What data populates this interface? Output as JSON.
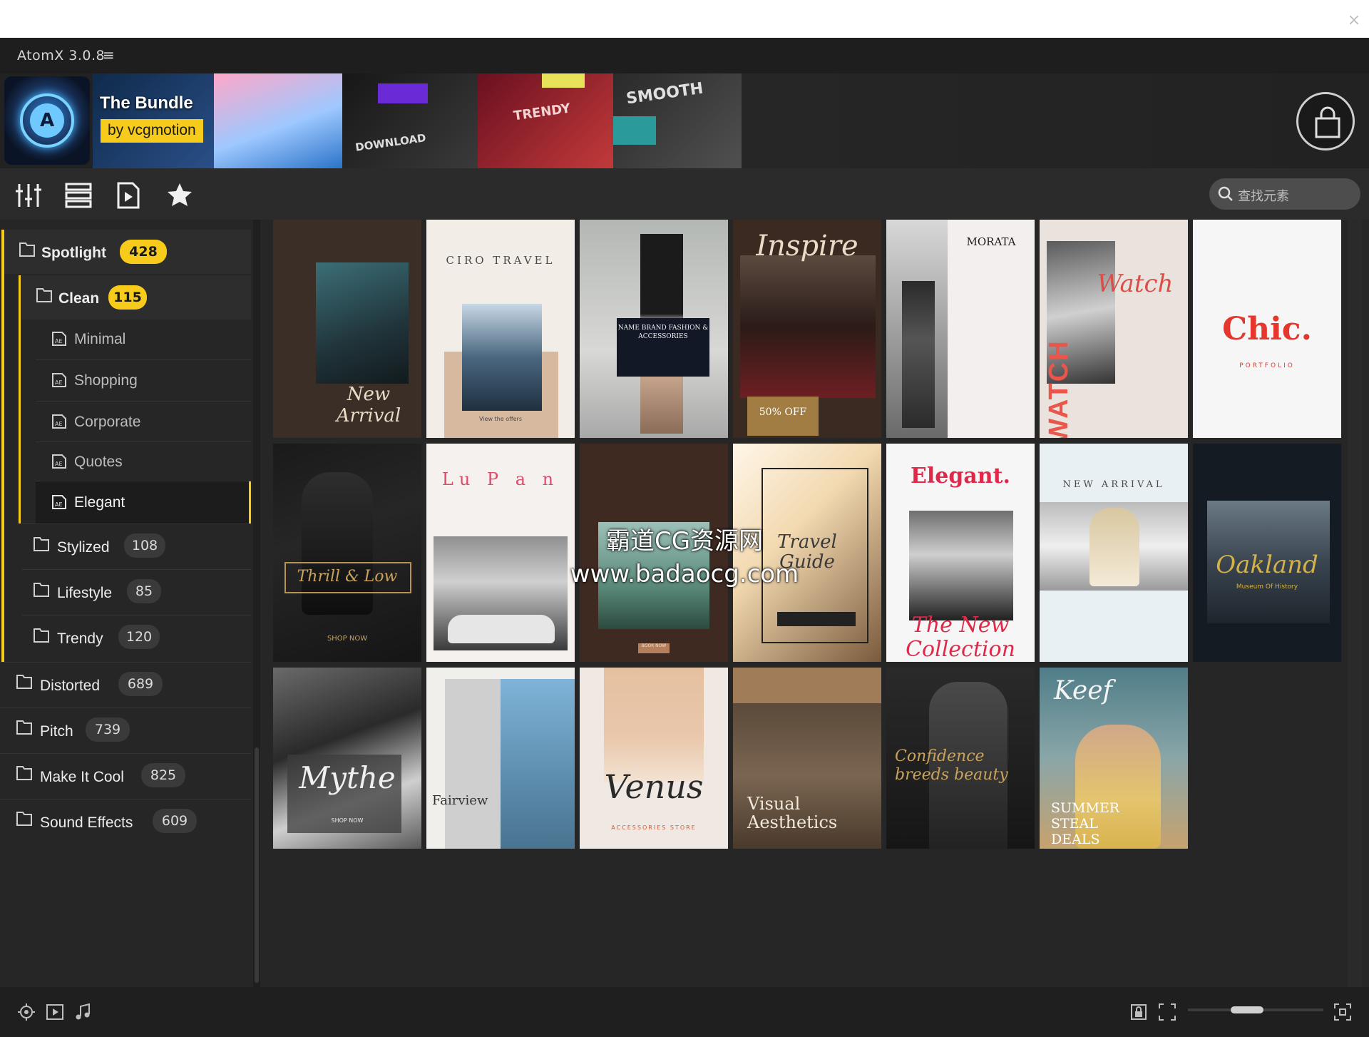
{
  "app": {
    "title": "AtomX 3.0.8",
    "menu_glyph": "≡",
    "close_glyph": "×"
  },
  "banner": {
    "title": "The Bundle",
    "byline": "by vcgmotion",
    "tile_texts": [
      "TRENDY",
      "DOWNLOAD",
      "SMOOTH",
      "TRENDY"
    ]
  },
  "toolbar": {
    "icons": [
      "sliders-icon",
      "list-icon",
      "video-file-icon",
      "star-icon"
    ],
    "search_placeholder": "查找元素"
  },
  "sidebar": {
    "categories": [
      {
        "label": "Spotlight",
        "count": "428"
      },
      {
        "label": "Clean",
        "count": "115"
      },
      {
        "label": "Minimal"
      },
      {
        "label": "Shopping"
      },
      {
        "label": "Corporate"
      },
      {
        "label": "Quotes"
      },
      {
        "label": "Elegant"
      },
      {
        "label": "Stylized",
        "count": "108"
      },
      {
        "label": "Lifestyle",
        "count": "85"
      },
      {
        "label": "Trendy",
        "count": "120"
      },
      {
        "label": "Distorted",
        "count": "689"
      },
      {
        "label": "Pitch",
        "count": "739"
      },
      {
        "label": "Make It Cool",
        "count": "825"
      },
      {
        "label": "Sound Effects",
        "count": "609"
      }
    ]
  },
  "grid": {
    "cards": [
      {
        "title": "New Arrival",
        "sub": ""
      },
      {
        "title": "CIRO TRAVEL",
        "sub": "View the offers"
      },
      {
        "title": "NAME BRAND FASHION & ACCESSORIES",
        "sub": ""
      },
      {
        "title": "Inspire",
        "sub": "50% OFF"
      },
      {
        "title": "MORATA",
        "sub": ""
      },
      {
        "title": "Watch",
        "sub": "WATCH"
      },
      {
        "title": "Chic.",
        "sub": "PORTFOLIO"
      },
      {
        "title": "Thrill & Low",
        "sub": "SHOP NOW"
      },
      {
        "title": "Lu P a n",
        "sub": ""
      },
      {
        "title": "",
        "sub": "BOOK NOW"
      },
      {
        "title": "Travel Guide",
        "sub": ""
      },
      {
        "title": "Elegant.",
        "sub": "The New Collection"
      },
      {
        "title": "NEW ARRIVAL",
        "sub": ""
      },
      {
        "title": "Oakland",
        "sub": "Museum Of History"
      },
      {
        "title": "Mythe",
        "sub": "SHOP NOW"
      },
      {
        "title": "Fairview",
        "sub": ""
      },
      {
        "title": "Venus",
        "sub": "ACCESSORIES STORE"
      },
      {
        "title": "Visual Aesthetics",
        "sub": ""
      },
      {
        "title": "Confidence breeds beauty",
        "sub": ""
      },
      {
        "title": "Keef",
        "sub": "SUMMER STEAL DEALS"
      }
    ]
  },
  "watermark": {
    "line1": "霸道CG资源网",
    "line2": "www.badaocg.com"
  },
  "colors": {
    "accent": "#f6cb1b",
    "bg": "#262626",
    "panel": "#2b2b2b"
  }
}
